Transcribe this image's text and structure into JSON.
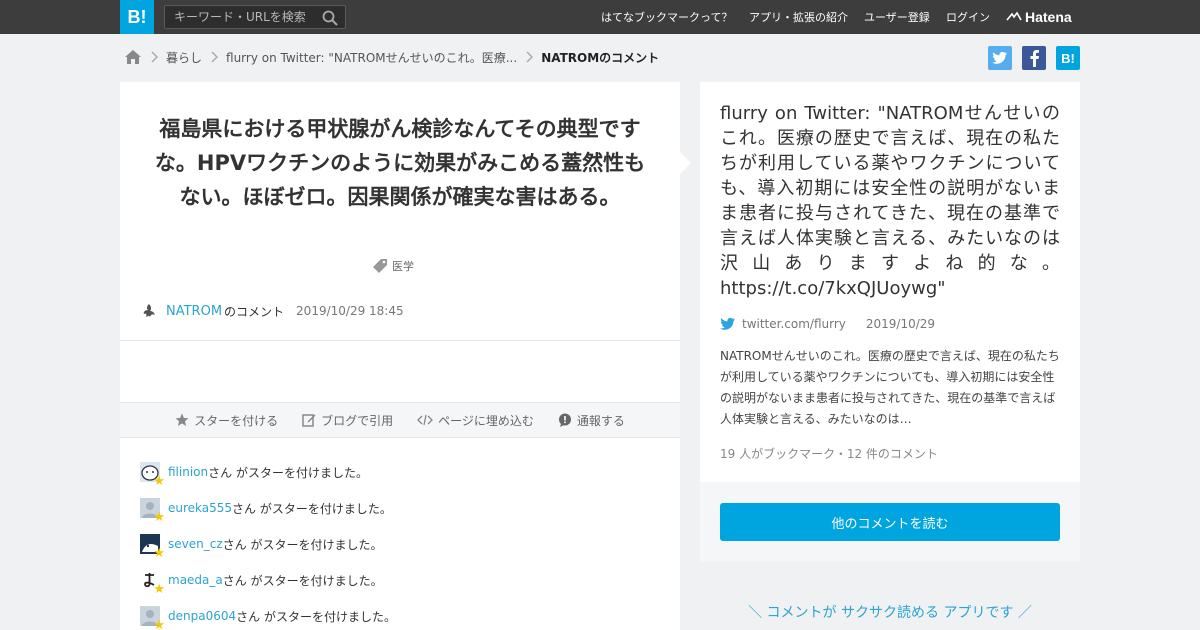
{
  "topbar": {
    "logo": "B!",
    "search_placeholder": "キーワード・URLを検索",
    "nav": {
      "about": "はてなブックマークって？",
      "apps": "アプリ・拡張の紹介",
      "register": "ユーザー登録",
      "login": "ログイン"
    },
    "brand": "Hatena"
  },
  "breadcrumb": {
    "category": "暮らし",
    "entry": "flurry on Twitter: \"NATROMせんせいのこれ。医療...",
    "current": "NATROMのコメント"
  },
  "share": {
    "twitter": "twitter-icon",
    "facebook": "facebook-icon",
    "hatena": "B!"
  },
  "comment": {
    "text": "福島県における甲状腺がん検診なんてその典型ですな。HPVワクチンのように効果がみこめる蓋然性もない。ほぼゼロ。因果関係が確実な害はある。",
    "tag": "医学",
    "author": "NATROM",
    "author_suffix": "のコメント",
    "date": "2019/10/29 18:45"
  },
  "actions": {
    "star": "スターを付ける",
    "blog": "ブログで引用",
    "embed": "ページに埋め込む",
    "report": "通報する"
  },
  "stars": [
    {
      "user": "filinion",
      "text": "さん がスターを付けました。"
    },
    {
      "user": "eureka555",
      "text": "さん がスターを付けました。"
    },
    {
      "user": "seven_cz",
      "text": "さん がスターを付けました。"
    },
    {
      "user": "maeda_a",
      "text": "さん がスターを付けました。"
    },
    {
      "user": "denpa0604",
      "text": "さん がスターを付けました。"
    }
  ],
  "entry": {
    "title": "flurry on Twitter: \"NATROMせんせいのこれ。医療の歴史で言えば、現在の私たちが利用している薬やワクチンについても、導入初期には安全性の説明がないまま患者に投与されてきた、現在の基準で言えば人体実験と言える、みたいなのは沢山ありますよね的な。https://t.co/7kxQJUoywg\"",
    "source": "twitter.com/flurry",
    "date": "2019/10/29",
    "summary": "NATROMせんせいのこれ。医療の歴史で言えば、現在の私たちが利用している薬やワクチンについても、導入初期には安全性の説明がないまま患者に投与されてきた、現在の基準で言えば人体実験と言える、みたいなのは…",
    "counts": "19 人がブックマーク・12 件のコメント",
    "read_more": "他のコメントを読む"
  },
  "promo": "＼ コメントが サクサク読める アプリです ／",
  "colors": {
    "accent": "#00a4de",
    "link": "#2ba4d1",
    "topbar": "#3d3d3d",
    "twitter": "#55acee",
    "facebook": "#3b5998"
  }
}
